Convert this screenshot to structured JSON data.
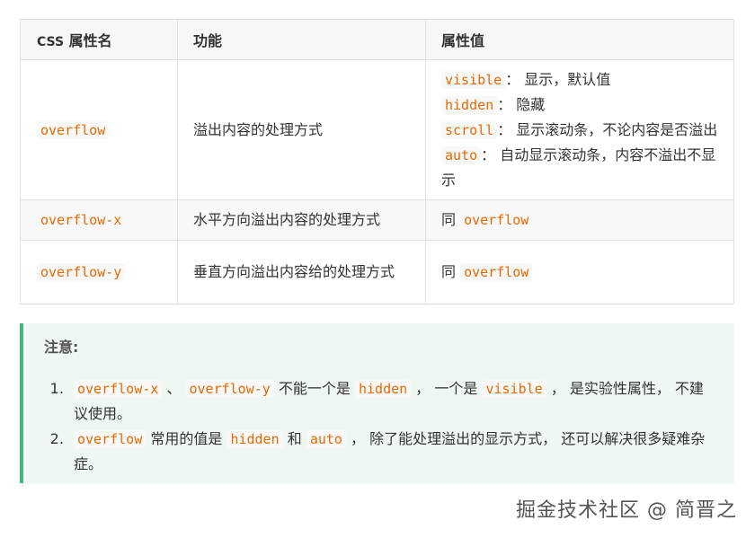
{
  "table": {
    "headers": {
      "col1_css": "CSS",
      "col1_rest": " 属性名",
      "col2": "功能",
      "col3": "属性值"
    },
    "rows": [
      {
        "name": "overflow",
        "desc": "溢出内容的处理方式",
        "values": [
          {
            "code": "visible",
            "text": "： 显示，默认值"
          },
          {
            "code": "hidden",
            "text": "： 隐藏"
          },
          {
            "code": "scroll",
            "text": "： 显示滚动条，不论内容是否溢出"
          },
          {
            "code": "auto",
            "text": "： 自动显示滚动条，内容不溢出不显示"
          }
        ]
      },
      {
        "name": "overflow-x",
        "desc": "水平方向溢出内容的处理方式",
        "same_prefix": "同 ",
        "same_code": "overflow"
      },
      {
        "name": "overflow-y",
        "desc": "垂直方向溢出内容给的处理方式",
        "same_prefix": "同 ",
        "same_code": "overflow"
      }
    ]
  },
  "note": {
    "title": "注意:",
    "items": [
      {
        "c1": "overflow-x",
        "t1": " 、 ",
        "c2": "overflow-y",
        "t2": " 不能一个是 ",
        "c3": "hidden",
        "t3": " ， 一个是 ",
        "c4": "visible",
        "t4": " ， 是实验性属性， 不建议使用。"
      },
      {
        "c1": "overflow",
        "t1": " 常用的值是 ",
        "c2": "hidden",
        "t2": " 和 ",
        "c3": "auto",
        "t3": " ， 除了能处理溢出的显示方式， 还可以解决很多疑难杂症。"
      }
    ]
  },
  "watermark": "掘金技术社区 @ 简晋之",
  "colors": {
    "code": "#e96900",
    "accent": "#42b983",
    "note_bg": "#eef7f2"
  }
}
